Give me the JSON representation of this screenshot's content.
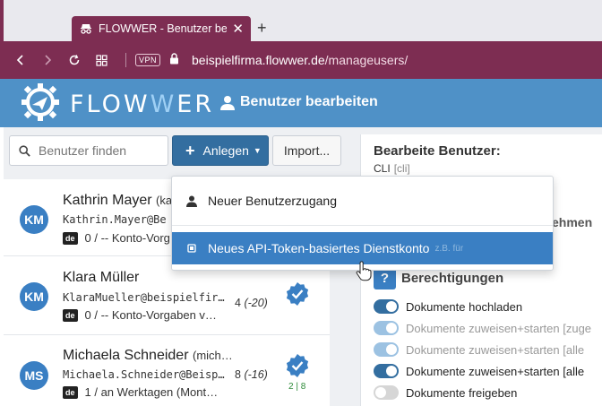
{
  "browser": {
    "tab_title": "FLOWWER - Benutzer bearbeiten",
    "close_glyph": "✕",
    "new_tab_glyph": "+",
    "vpn_label": "VPN",
    "url_domain": "beispielfirma.flowwer.de",
    "url_path": "/manageusers/",
    "accent_color": "#7d2d52"
  },
  "header": {
    "logo_left": "FLOW",
    "logo_w": "W",
    "logo_right": "ER",
    "page_title": "Benutzer bearbeiten",
    "background": "#4f91c7"
  },
  "toolbar": {
    "search_placeholder": "Benutzer finden",
    "create_plus": "+",
    "create_label": "Anlegen",
    "import_label": "Import..."
  },
  "dropdown": {
    "items": [
      {
        "label": "Neuer Benutzerzugang",
        "icon": "user-icon"
      },
      {
        "label": "Neues API-Token-basiertes Dienstkonto",
        "icon": "chip-icon",
        "ghost": "z.B. für"
      }
    ]
  },
  "users": [
    {
      "initials": "KM",
      "name": "Kathrin Mayer",
      "name_suffix": "(kat",
      "login": "Kathrin.Mayer@Be",
      "lang": "de",
      "status": "0 / -- Konto-Vorg"
    },
    {
      "initials": "KM",
      "name": "Klara Müller",
      "name_suffix": "",
      "login": "KlaraMueller@beispielfir…",
      "lang": "de",
      "status": "0 / -- Konto-Vorgaben v…",
      "count": "4",
      "count_delta": "(-20)"
    },
    {
      "initials": "MS",
      "name": "Michaela Schneider",
      "name_suffix": "(mich…",
      "login": "Michaela.Schneider@Beisp…",
      "lang": "de",
      "status": "1 / an Werktagen (Mont…",
      "count": "8",
      "count_delta": "(-16)",
      "verified_left": "2",
      "verified_right": "8"
    }
  ],
  "editor": {
    "title": "Bearbeite Benutzer:",
    "subtitle": "CLI",
    "subtitle_muted": "[cli]",
    "obscured_text": "ehmen",
    "permissions_icon": "?",
    "permissions_title": "Berechtigungen",
    "permissions": [
      {
        "label": "Dokumente hochladen",
        "state": "on"
      },
      {
        "label": "Dokumente zuweisen+starten [zuge",
        "state": "soft"
      },
      {
        "label": "Dokumente zuweisen+starten [alle",
        "state": "soft"
      },
      {
        "label": "Dokumente zuweisen+starten [alle",
        "state": "on"
      },
      {
        "label": "Dokumente freigeben",
        "state": "off"
      }
    ]
  }
}
